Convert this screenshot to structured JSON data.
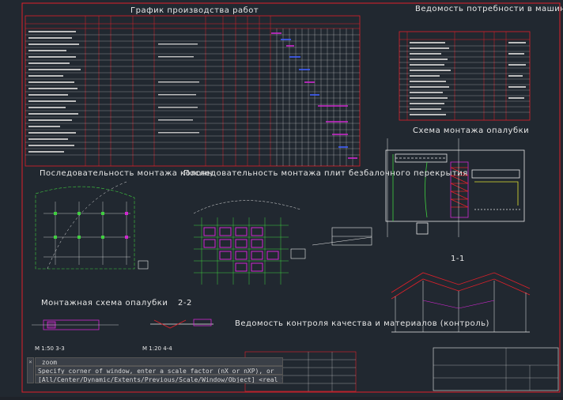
{
  "drawing": {
    "title_schedule": "График производства работ",
    "title_needs": "Ведомость потребности в машинах, оборудовании и инструменте",
    "title_scheme": "Схема монтажа опалубки",
    "title_seq_left": "Последовательность монтажа колонн",
    "title_seq_center": "Последовательность монтажа плит безбалочного перекрытия",
    "title_section_left": "Монтажная схема опалубки",
    "title_22": "2-2",
    "title_11": "1-1",
    "title_qa": "Ведомость контроля качества и материалов (контроль)",
    "scale_33": "М 1:50   3-3",
    "scale_44": "М 1:20   4-4"
  },
  "command_line": {
    "history": "_zoom",
    "line1": "Specify corner of window, enter a scale factor (nX or nXP), or",
    "line2": "[All/Center/Dynamic/Extents/Previous/Scale/Window/Object] <real time>: _e"
  },
  "colors": {
    "background": "#212830",
    "border_red": "#e0202a",
    "magenta": "#d028d0",
    "green": "#30d030",
    "cyan": "#40d0d0",
    "yellow": "#e0e030",
    "white": "#e8e8e8"
  }
}
